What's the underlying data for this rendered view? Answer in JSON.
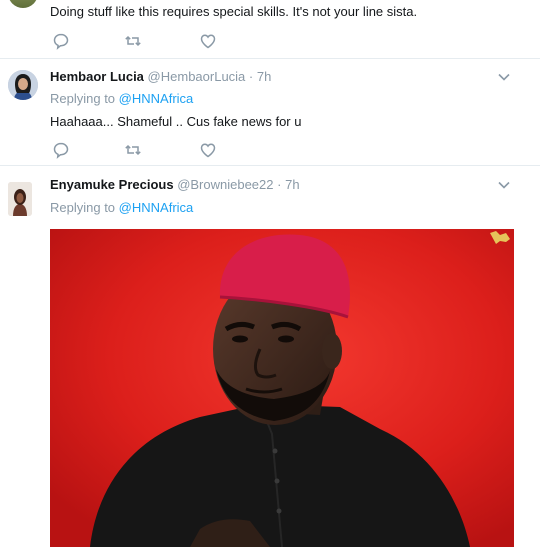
{
  "tweets": [
    {
      "text": "Doing stuff like this requires special skills. It's not your line sista."
    },
    {
      "name": "Hembaor Lucia",
      "handle": "@HembaorLucia",
      "dot": "·",
      "time": "7h",
      "reply_prefix": "Replying to",
      "reply_handle": "@HNNAfrica",
      "text": "Haahaaa... Shameful .. Cus fake news for u"
    },
    {
      "name": "Enyamuke Precious",
      "handle": "@Browniebee22",
      "dot": "·",
      "time": "7h",
      "reply_prefix": "Replying to",
      "reply_handle": "@HNNAfrica"
    }
  ],
  "icons": {
    "reply": "reply-icon",
    "retweet": "retweet-icon",
    "like": "heart-icon",
    "caret": "chevron-down-icon"
  },
  "colors": {
    "link": "#1da1f2",
    "muted": "#8a99a6",
    "divider": "#e6ecf0",
    "photo_background": "#dd1f1c",
    "cap": "#d81e4a"
  }
}
